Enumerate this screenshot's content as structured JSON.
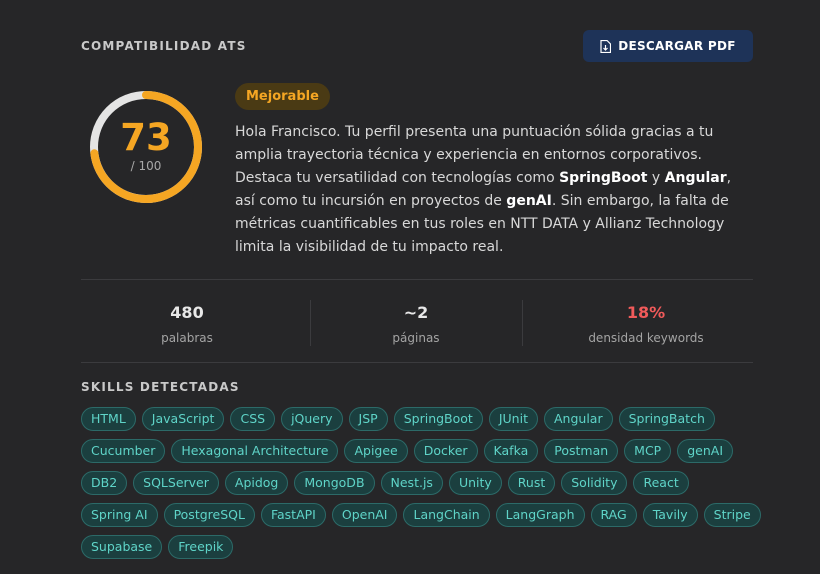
{
  "header": {
    "title": "COMPATIBILIDAD ATS",
    "download_label": "DESCARGAR PDF"
  },
  "score": {
    "value": "73",
    "max_label": "/ 100",
    "fraction": 0.73
  },
  "badge": "Mejorable",
  "summary": {
    "p1": "Hola Francisco. Tu perfil presenta una puntuación sólida gracias a tu amplia trayectoria técnica y experiencia en entornos corporativos. Destaca tu versatilidad con tecnologías como ",
    "k1": "SpringBoot",
    "p2": " y ",
    "k2": "Angular",
    "p3": ", así como tu incursión en proyectos de ",
    "k3": "genAI",
    "p4": ". Sin embargo, la falta de métricas cuantificables en tus roles en NTT DATA y Allianz Technology limita la visibilidad de tu impacto real."
  },
  "stats": [
    {
      "value": "480",
      "label": "palabras",
      "color": "#e8e8e8"
    },
    {
      "value": "~2",
      "label": "páginas",
      "color": "#e8e8e8"
    },
    {
      "value": "18%",
      "label": "densidad keywords",
      "color": "#f05a5a"
    }
  ],
  "skills_title": "SKILLS DETECTADAS",
  "skills": [
    "HTML",
    "JavaScript",
    "CSS",
    "jQuery",
    "JSP",
    "SpringBoot",
    "JUnit",
    "Angular",
    "SpringBatch",
    "Cucumber",
    "Hexagonal Architecture",
    "Apigee",
    "Docker",
    "Kafka",
    "Postman",
    "MCP",
    "genAI",
    "DB2",
    "SQLServer",
    "Apidog",
    "MongoDB",
    "Nest.js",
    "Unity",
    "Rust",
    "Solidity",
    "React",
    "Spring AI",
    "PostgreSQL",
    "FastAPI",
    "OpenAI",
    "LangChain",
    "LangGraph",
    "RAG",
    "Tavily",
    "Stripe",
    "Supabase",
    "Freepik"
  ],
  "colors": {
    "accent": "#f5a623",
    "chip_text": "#5fd4c8",
    "button_bg": "#1e3358"
  }
}
